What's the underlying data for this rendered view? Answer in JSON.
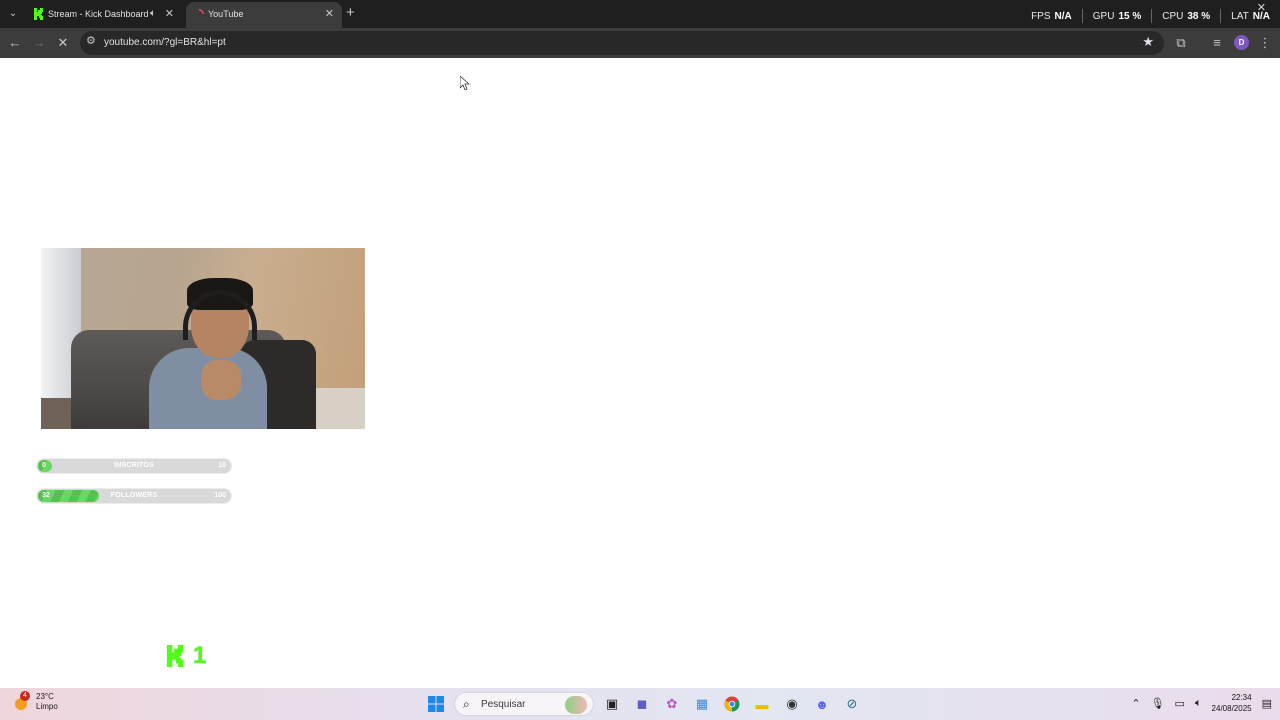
{
  "browser": {
    "tabs": [
      {
        "title": "Stream - Kick Dashboard",
        "favicon": "kick-icon",
        "audio": true,
        "active": false
      },
      {
        "title": "YouTube",
        "favicon": "youtube-loading-icon",
        "active": true
      }
    ],
    "url": "youtube.com/?gl=BR&hl=pt",
    "profile_initial": "D"
  },
  "overlay_stats": {
    "fps_label": "FPS",
    "fps_value": "N/A",
    "gpu_label": "GPU",
    "gpu_value": "15 %",
    "cpu_label": "CPU",
    "cpu_value": "38 %",
    "lat_label": "LAT",
    "lat_value": "N/A"
  },
  "goals": [
    {
      "start": "0",
      "label": "INSCRITOS",
      "end": "10",
      "progress": 0.05
    },
    {
      "start": "32",
      "label": "FOLLOWERS",
      "end": "100",
      "progress": 0.32
    }
  ],
  "kick_counter": {
    "value": "1",
    "color": "#53fc18"
  },
  "taskbar": {
    "weather_temp": "23°C",
    "weather_desc": "Limpo",
    "weather_badge": "4",
    "search_placeholder": "Pesquisar",
    "time": "22:34",
    "date": "24/08/2025"
  }
}
